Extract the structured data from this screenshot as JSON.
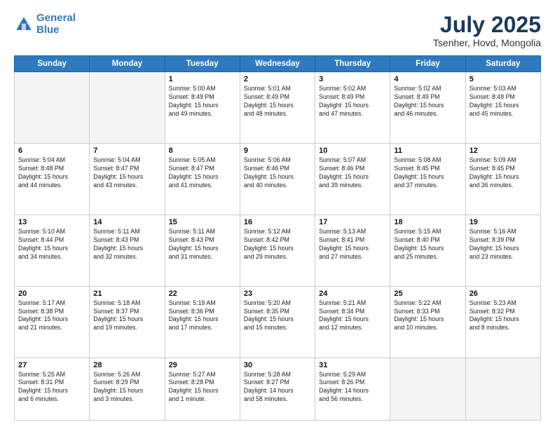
{
  "header": {
    "logo_line1": "General",
    "logo_line2": "Blue",
    "month_year": "July 2025",
    "location": "Tsenher, Hovd, Mongolia"
  },
  "weekdays": [
    "Sunday",
    "Monday",
    "Tuesday",
    "Wednesday",
    "Thursday",
    "Friday",
    "Saturday"
  ],
  "weeks": [
    [
      {
        "day": "",
        "info": ""
      },
      {
        "day": "",
        "info": ""
      },
      {
        "day": "1",
        "info": "Sunrise: 5:00 AM\nSunset: 8:49 PM\nDaylight: 15 hours\nand 49 minutes."
      },
      {
        "day": "2",
        "info": "Sunrise: 5:01 AM\nSunset: 8:49 PM\nDaylight: 15 hours\nand 48 minutes."
      },
      {
        "day": "3",
        "info": "Sunrise: 5:02 AM\nSunset: 8:49 PM\nDaylight: 15 hours\nand 47 minutes."
      },
      {
        "day": "4",
        "info": "Sunrise: 5:02 AM\nSunset: 8:49 PM\nDaylight: 15 hours\nand 46 minutes."
      },
      {
        "day": "5",
        "info": "Sunrise: 5:03 AM\nSunset: 8:48 PM\nDaylight: 15 hours\nand 45 minutes."
      }
    ],
    [
      {
        "day": "6",
        "info": "Sunrise: 5:04 AM\nSunset: 8:48 PM\nDaylight: 15 hours\nand 44 minutes."
      },
      {
        "day": "7",
        "info": "Sunrise: 5:04 AM\nSunset: 8:47 PM\nDaylight: 15 hours\nand 43 minutes."
      },
      {
        "day": "8",
        "info": "Sunrise: 5:05 AM\nSunset: 8:47 PM\nDaylight: 15 hours\nand 41 minutes."
      },
      {
        "day": "9",
        "info": "Sunrise: 5:06 AM\nSunset: 8:46 PM\nDaylight: 15 hours\nand 40 minutes."
      },
      {
        "day": "10",
        "info": "Sunrise: 5:07 AM\nSunset: 8:46 PM\nDaylight: 15 hours\nand 39 minutes."
      },
      {
        "day": "11",
        "info": "Sunrise: 5:08 AM\nSunset: 8:45 PM\nDaylight: 15 hours\nand 37 minutes."
      },
      {
        "day": "12",
        "info": "Sunrise: 5:09 AM\nSunset: 8:45 PM\nDaylight: 15 hours\nand 36 minutes."
      }
    ],
    [
      {
        "day": "13",
        "info": "Sunrise: 5:10 AM\nSunset: 8:44 PM\nDaylight: 15 hours\nand 34 minutes."
      },
      {
        "day": "14",
        "info": "Sunrise: 5:11 AM\nSunset: 8:43 PM\nDaylight: 15 hours\nand 32 minutes."
      },
      {
        "day": "15",
        "info": "Sunrise: 5:11 AM\nSunset: 8:43 PM\nDaylight: 15 hours\nand 31 minutes."
      },
      {
        "day": "16",
        "info": "Sunrise: 5:12 AM\nSunset: 8:42 PM\nDaylight: 15 hours\nand 29 minutes."
      },
      {
        "day": "17",
        "info": "Sunrise: 5:13 AM\nSunset: 8:41 PM\nDaylight: 15 hours\nand 27 minutes."
      },
      {
        "day": "18",
        "info": "Sunrise: 5:15 AM\nSunset: 8:40 PM\nDaylight: 15 hours\nand 25 minutes."
      },
      {
        "day": "19",
        "info": "Sunrise: 5:16 AM\nSunset: 8:39 PM\nDaylight: 15 hours\nand 23 minutes."
      }
    ],
    [
      {
        "day": "20",
        "info": "Sunrise: 5:17 AM\nSunset: 8:38 PM\nDaylight: 15 hours\nand 21 minutes."
      },
      {
        "day": "21",
        "info": "Sunrise: 5:18 AM\nSunset: 8:37 PM\nDaylight: 15 hours\nand 19 minutes."
      },
      {
        "day": "22",
        "info": "Sunrise: 5:19 AM\nSunset: 8:36 PM\nDaylight: 15 hours\nand 17 minutes."
      },
      {
        "day": "23",
        "info": "Sunrise: 5:20 AM\nSunset: 8:35 PM\nDaylight: 15 hours\nand 15 minutes."
      },
      {
        "day": "24",
        "info": "Sunrise: 5:21 AM\nSunset: 8:34 PM\nDaylight: 15 hours\nand 12 minutes."
      },
      {
        "day": "25",
        "info": "Sunrise: 5:22 AM\nSunset: 8:33 PM\nDaylight: 15 hours\nand 10 minutes."
      },
      {
        "day": "26",
        "info": "Sunrise: 5:23 AM\nSunset: 8:32 PM\nDaylight: 15 hours\nand 8 minutes."
      }
    ],
    [
      {
        "day": "27",
        "info": "Sunrise: 5:25 AM\nSunset: 8:31 PM\nDaylight: 15 hours\nand 6 minutes."
      },
      {
        "day": "28",
        "info": "Sunrise: 5:26 AM\nSunset: 8:29 PM\nDaylight: 15 hours\nand 3 minutes."
      },
      {
        "day": "29",
        "info": "Sunrise: 5:27 AM\nSunset: 8:28 PM\nDaylight: 15 hours\nand 1 minute."
      },
      {
        "day": "30",
        "info": "Sunrise: 5:28 AM\nSunset: 8:27 PM\nDaylight: 14 hours\nand 58 minutes."
      },
      {
        "day": "31",
        "info": "Sunrise: 5:29 AM\nSunset: 8:26 PM\nDaylight: 14 hours\nand 56 minutes."
      },
      {
        "day": "",
        "info": ""
      },
      {
        "day": "",
        "info": ""
      }
    ]
  ]
}
